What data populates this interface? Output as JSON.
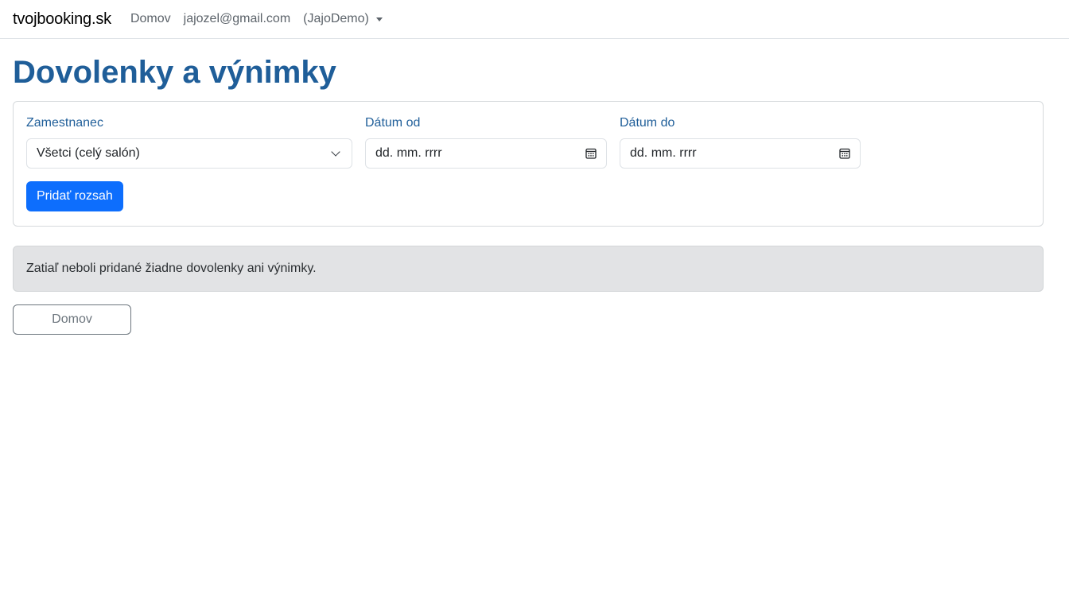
{
  "navbar": {
    "brand": "tvojbooking.sk",
    "home_link": "Domov",
    "user_email": "jajozel@gmail.com",
    "user_account": "(JajoDemo)"
  },
  "page": {
    "title": "Dovolenky a výnimky"
  },
  "form": {
    "employee_label": "Zamestnanec",
    "employee_selected": "Všetci (celý salón)",
    "date_from_label": "Dátum od",
    "date_from_placeholder": "dd. mm. rrrr",
    "date_to_label": "Dátum do",
    "date_to_placeholder": "dd. mm. rrrr",
    "add_button": "Pridať rozsah"
  },
  "alert": {
    "empty_message": "Zatiaľ neboli pridané žiadne dovolenky ani výnimky."
  },
  "footer": {
    "home_button": "Domov"
  },
  "colors": {
    "heading": "#1f5e99",
    "primary": "#0d6efd",
    "alert_bg": "#e2e3e5"
  },
  "icons": [
    "chevron-down-icon",
    "calendar-icon",
    "caret-down-icon"
  ]
}
